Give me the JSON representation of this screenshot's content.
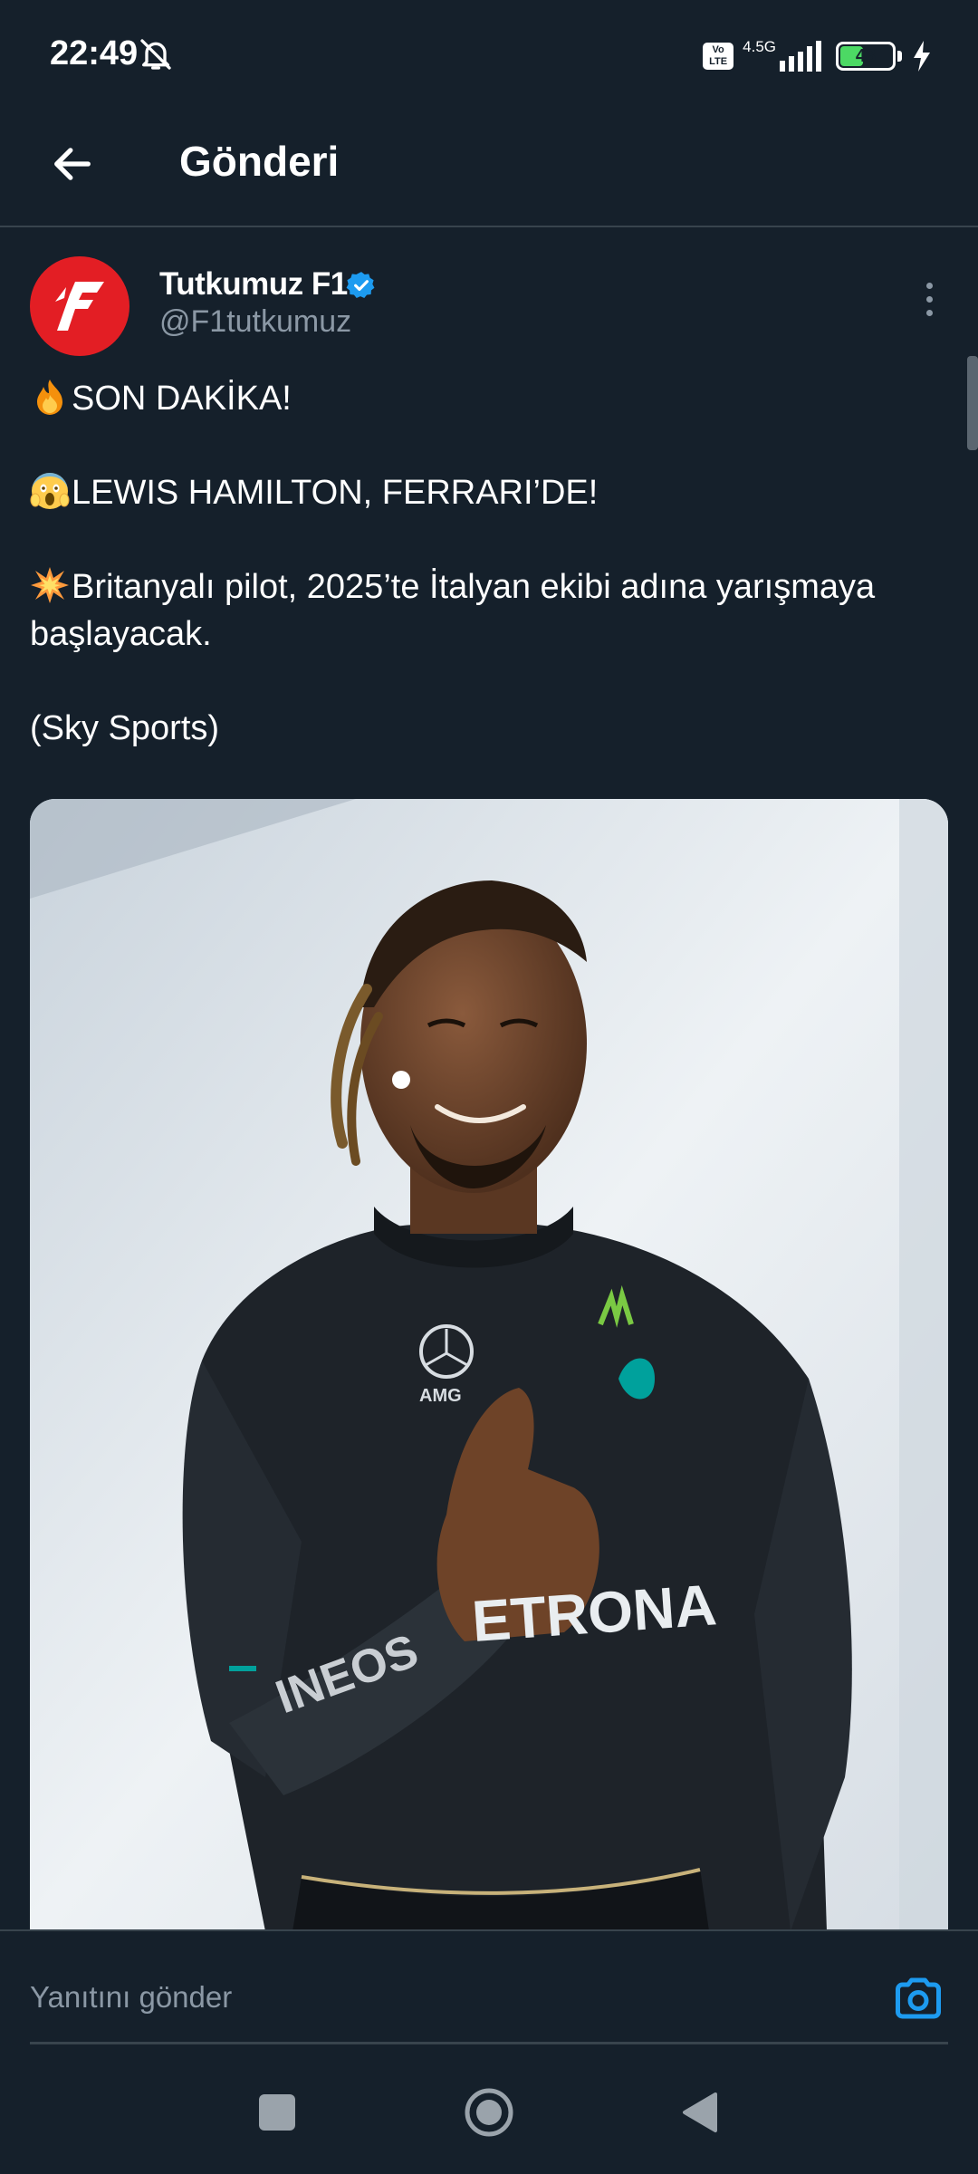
{
  "status_bar": {
    "time": "22:49",
    "network_badge": "Vo LTE",
    "network_generation": "4.5G",
    "battery_level": "48",
    "battery_fraction": 0.48
  },
  "top_bar": {
    "title": "Gönderi",
    "back_icon": "arrow-left-icon"
  },
  "post": {
    "author_name": "Tutkumuz F1",
    "author_handle": "@F1tutkumuz",
    "verified": true,
    "lines": [
      {
        "emoji": "fire",
        "text": "SON DAKİKA!"
      },
      {
        "emoji": "scream",
        "text": "LEWIS HAMILTON, FERRARI’DE!"
      },
      {
        "emoji": "collision",
        "text": "Britanyalı pilot, 2025’te İtalyan ekibi adına yarışmaya başlayacak."
      },
      {
        "emoji": "",
        "text": "(Sky Sports)"
      }
    ]
  },
  "reply": {
    "placeholder": "Yanıtını gönder",
    "camera_icon": "camera-icon"
  },
  "nav": {
    "recent_icon": "square-icon",
    "home_icon": "circle-icon",
    "back_icon": "triangle-back-icon"
  },
  "colors": {
    "background": "#15202b",
    "accent": "#1d9bf0",
    "avatar_red": "#e31e24",
    "secondary_text": "#8b98a5",
    "battery_green": "#4cd964"
  }
}
